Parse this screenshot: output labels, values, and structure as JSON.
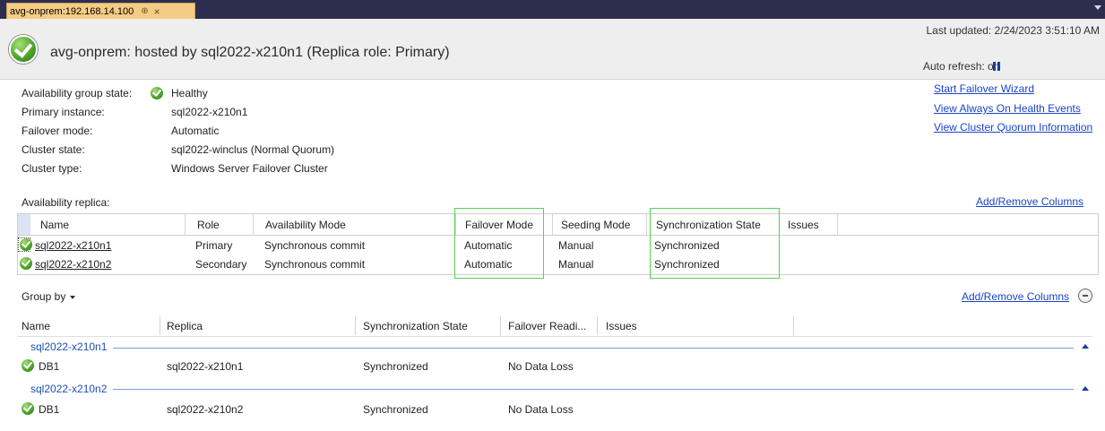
{
  "tab": {
    "title": "avg-onprem:192.168.14.100",
    "pin_glyph": "⊕",
    "close_glyph": "×"
  },
  "header": {
    "title": "avg-onprem: hosted by sql2022-x210n1 (Replica role: Primary)",
    "last_updated": "Last updated: 2/24/2023 3:51:10 AM",
    "auto_refresh": "Auto refresh: on"
  },
  "info": {
    "ag_state_label": "Availability group state:",
    "ag_state_value": "Healthy",
    "primary_label": "Primary instance:",
    "primary_value": "sql2022-x210n1",
    "failover_label": "Failover mode:",
    "failover_value": "Automatic",
    "cluster_state_label": "Cluster state:",
    "cluster_state_value": "sql2022-winclus (Normal Quorum)",
    "cluster_type_label": "Cluster type:",
    "cluster_type_value": "Windows Server Failover Cluster"
  },
  "links": {
    "start_failover": "Start Failover Wizard",
    "health_events": "View Always On Health Events",
    "cluster_quorum": "View Cluster Quorum Information",
    "add_remove_columns_1": "Add/Remove Columns",
    "add_remove_columns_2": "Add/Remove Columns"
  },
  "replica_section": {
    "label": "Availability replica:",
    "columns": [
      "Name",
      "Role",
      "Availability Mode",
      "Failover Mode",
      "Seeding Mode",
      "Synchronization State",
      "Issues"
    ],
    "rows": [
      {
        "name": "sql2022-x210n1",
        "role": "Primary",
        "availability_mode": "Synchronous commit",
        "failover_mode": "Automatic",
        "seeding_mode": "Manual",
        "sync_state": "Synchronized",
        "issues": ""
      },
      {
        "name": "sql2022-x210n2",
        "role": "Secondary",
        "availability_mode": "Synchronous commit",
        "failover_mode": "Automatic",
        "seeding_mode": "Manual",
        "sync_state": "Synchronized",
        "issues": ""
      }
    ]
  },
  "database_section": {
    "group_by": "Group by",
    "columns": [
      "Name",
      "Replica",
      "Synchronization State",
      "Failover Readi...",
      "Issues"
    ],
    "groups": [
      {
        "label": "sql2022-x210n1",
        "rows": [
          {
            "name": "DB1",
            "replica": "sql2022-x210n1",
            "sync_state": "Synchronized",
            "failover_readiness": "No Data Loss"
          }
        ]
      },
      {
        "label": "sql2022-x210n2",
        "rows": [
          {
            "name": "DB1",
            "replica": "sql2022-x210n2",
            "sync_state": "Synchronized",
            "failover_readiness": "No Data Loss"
          }
        ]
      }
    ]
  },
  "colors": {
    "link": "#1a44c8",
    "highlight_box": "#55d255",
    "tab": "#f5cc84",
    "tabstrip": "#2d2d50",
    "group_label": "#1e4fb4"
  }
}
